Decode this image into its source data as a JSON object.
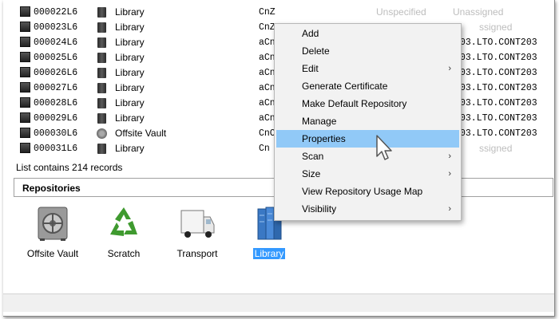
{
  "volumes": [
    {
      "id": "000022L6",
      "location": "Library",
      "code": "CnZ",
      "tail": "",
      "s1": "Unspecified",
      "s2": "Unassigned"
    },
    {
      "id": "000023L6",
      "location": "Library",
      "code": "CnZ",
      "tail": "",
      "s1": "",
      "s2": "ssigned"
    },
    {
      "id": "000024L6",
      "location": "Library",
      "code": "aCn",
      "tail": "03.LTO.CONT203",
      "s1": "",
      "s2": ""
    },
    {
      "id": "000025L6",
      "location": "Library",
      "code": "aCn",
      "tail": "03.LTO.CONT203",
      "s1": "",
      "s2": ""
    },
    {
      "id": "000026L6",
      "location": "Library",
      "code": "aCn",
      "tail": "03.LTO.CONT203",
      "s1": "",
      "s2": ""
    },
    {
      "id": "000027L6",
      "location": "Library",
      "code": "aCn",
      "tail": "03.LTO.CONT203",
      "s1": "",
      "s2": ""
    },
    {
      "id": "000028L6",
      "location": "Library",
      "code": "aCn",
      "tail": "03.LTO.CONT203",
      "s1": "",
      "s2": ""
    },
    {
      "id": "000029L6",
      "location": "Library",
      "code": "aCn",
      "tail": "03.LTO.CONT203",
      "s1": "",
      "s2": ""
    },
    {
      "id": "000030L6",
      "location": "Offsite Vault",
      "code": "CnC",
      "tail": "03.LTO.CONT203",
      "s1": "",
      "s2": ""
    },
    {
      "id": "000031L6",
      "location": "Library",
      "code": "Cn",
      "tail": "",
      "s1": "",
      "s2": "ssigned"
    }
  ],
  "records_text": "List contains 214 records",
  "repositories": {
    "header": "Repositories",
    "items": [
      {
        "label": "Offsite Vault",
        "icon": "vault-icon",
        "selected": false
      },
      {
        "label": "Scratch",
        "icon": "recycle-icon",
        "selected": false
      },
      {
        "label": "Transport",
        "icon": "truck-icon",
        "selected": false
      },
      {
        "label": "Library",
        "icon": "library-icon",
        "selected": true
      }
    ]
  },
  "context_menu": {
    "items": [
      {
        "label": "Add",
        "submenu": false
      },
      {
        "label": "Delete",
        "submenu": false
      },
      {
        "label": "Edit",
        "submenu": true
      },
      {
        "label": "Generate Certificate",
        "submenu": false
      },
      {
        "label": "Make Default Repository",
        "submenu": false
      },
      {
        "label": "Manage",
        "submenu": false
      },
      {
        "label": "Properties",
        "submenu": false,
        "highlighted": true
      },
      {
        "label": "Scan",
        "submenu": true
      },
      {
        "label": "Size",
        "submenu": true
      },
      {
        "label": "View Repository Usage Map",
        "submenu": false
      },
      {
        "label": "Visibility",
        "submenu": true
      }
    ],
    "submenu_arrow": "›"
  },
  "colors": {
    "highlight": "#91c9f7",
    "selection": "#3399ff"
  }
}
